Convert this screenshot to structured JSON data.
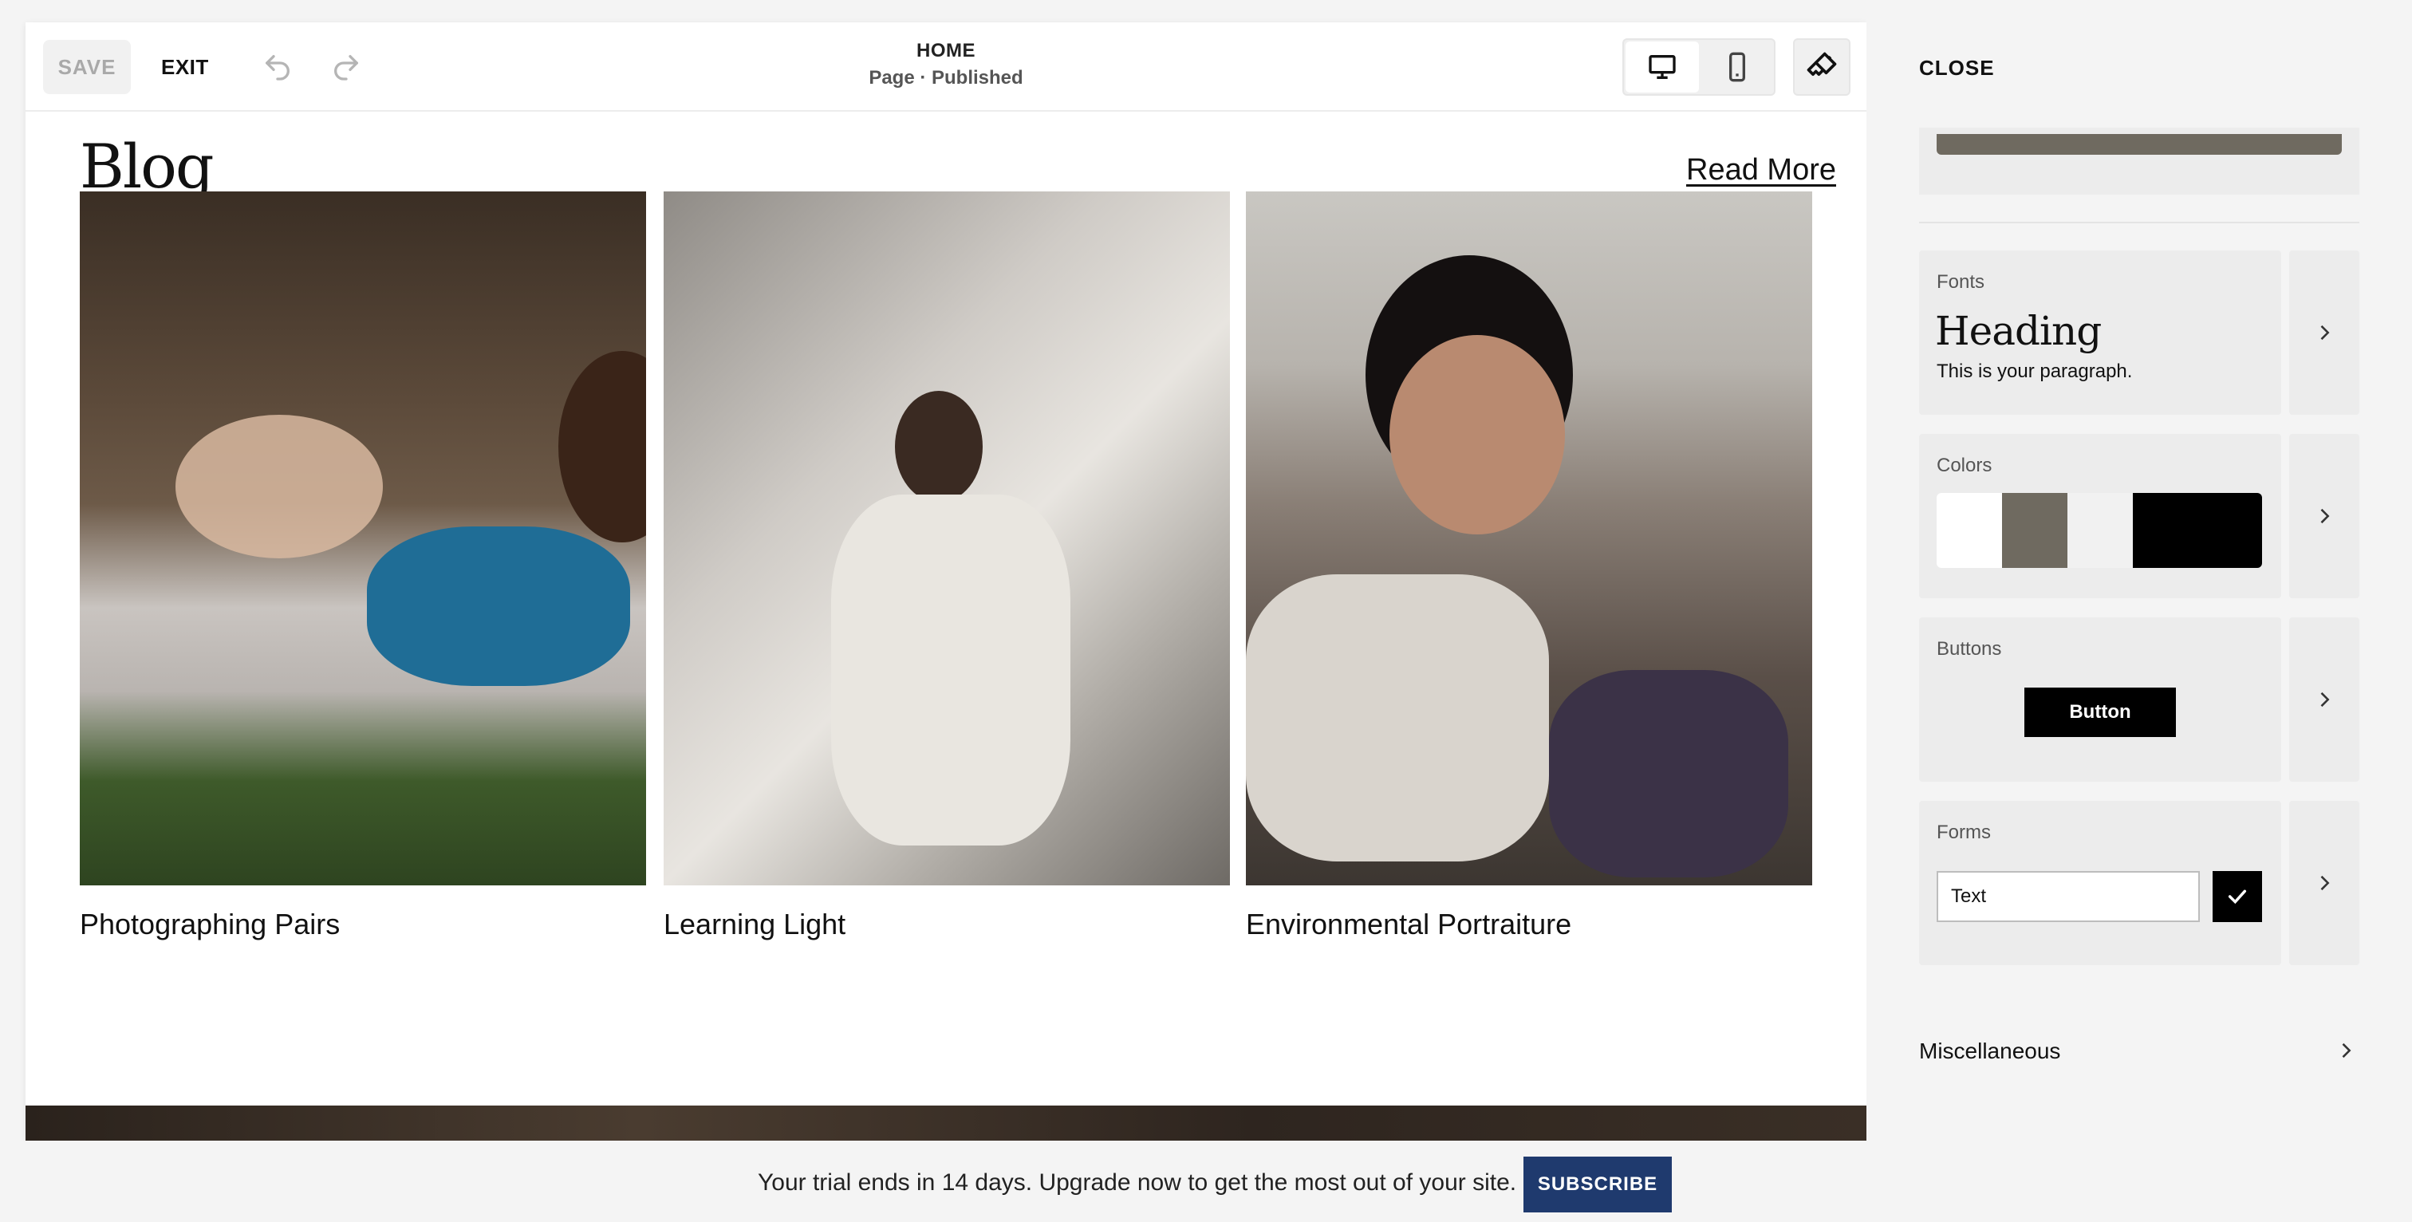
{
  "toolbar": {
    "save_label": "SAVE",
    "exit_label": "EXIT",
    "page_title": "HOME",
    "page_status": "Page · Published"
  },
  "canvas": {
    "blog_heading": "Blog",
    "read_more": "Read More",
    "posts": [
      {
        "title": "Photographing Pairs"
      },
      {
        "title": "Learning Light"
      },
      {
        "title": "Environmental Portraiture"
      }
    ]
  },
  "panel": {
    "close_label": "CLOSE",
    "fonts": {
      "label": "Fonts",
      "heading_sample": "Heading",
      "paragraph_sample": "This is your paragraph."
    },
    "colors": {
      "label": "Colors",
      "swatches": [
        "#ffffff",
        "#6f6a60",
        "#f1f1f1",
        "#000000"
      ]
    },
    "buttons": {
      "label": "Buttons",
      "button_sample": "Button"
    },
    "forms": {
      "label": "Forms",
      "input_sample": "Text"
    },
    "misc_label": "Miscellaneous"
  },
  "banner": {
    "trial_text": "Your trial ends in 14 days. Upgrade now to get the most out of your site.",
    "subscribe_label": "SUBSCRIBE"
  },
  "colors": {
    "accent": "#1f3a6e",
    "save_disabled": "#a9a9a9"
  }
}
